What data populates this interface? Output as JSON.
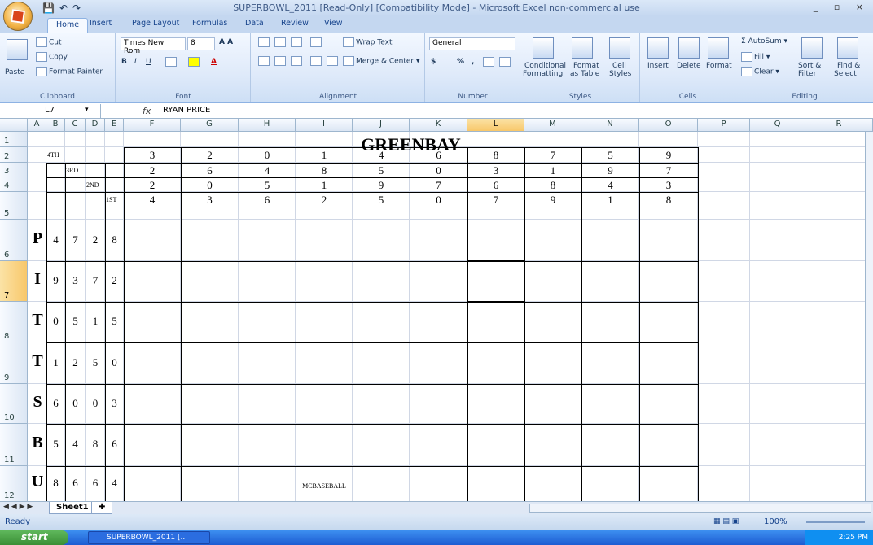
{
  "window": {
    "title": "SUPERBOWL_2011  [Read-Only]  [Compatibility Mode] - Microsoft Excel non-commercial use",
    "controls": "_ ▫ ×"
  },
  "qat": {
    "save": "💾",
    "undo": "↶",
    "redo": "↷"
  },
  "ribbon": {
    "tabs": [
      "Home",
      "Insert",
      "Page Layout",
      "Formulas",
      "Data",
      "Review",
      "View"
    ],
    "clipboard": {
      "paste": "Paste",
      "cut": "Cut",
      "copy": "Copy",
      "format_painter": "Format Painter",
      "label": "Clipboard"
    },
    "font": {
      "name": "Times New Rom",
      "size": "8",
      "label": "Font"
    },
    "alignment": {
      "wrap": "Wrap Text",
      "merge": "Merge & Center",
      "label": "Alignment"
    },
    "number": {
      "format": "General",
      "currency": "$",
      "percent": "%",
      "comma": ",",
      "label": "Number"
    },
    "styles": {
      "conditional": "Conditional",
      "conditional2": "Formatting",
      "format_table": "Format",
      "format_table2": "as Table",
      "cell_styles": "Cell",
      "cell_styles2": "Styles",
      "label": "Styles"
    },
    "cells": {
      "insert": "Insert",
      "delete": "Delete",
      "format": "Format",
      "label": "Cells"
    },
    "editing": {
      "autosum": "AutoSum",
      "fill": "Fill",
      "clear": "Clear",
      "sort": "Sort &",
      "sort2": "Filter",
      "find": "Find &",
      "find2": "Select",
      "label": "Editing"
    }
  },
  "formula_bar": {
    "name_box": "L7",
    "fx": "fx",
    "content": "RYAN PRICE"
  },
  "columns": [
    "A",
    "B",
    "C",
    "D",
    "E",
    "F",
    "G",
    "H",
    "I",
    "J",
    "K",
    "L",
    "M",
    "N",
    "O",
    "P",
    "Q",
    "R"
  ],
  "rows": [
    "1",
    "2",
    "3",
    "4",
    "5",
    "6",
    "7",
    "8",
    "9",
    "10",
    "11",
    "12"
  ],
  "sheet": {
    "title": "GREENBAY",
    "quarter_labels": [
      "4TH",
      "3RD",
      "2ND",
      "1ST"
    ],
    "greenbay_numbers": [
      [
        "3",
        "2",
        "0",
        "1",
        "4",
        "6",
        "8",
        "7",
        "5",
        "9"
      ],
      [
        "2",
        "6",
        "4",
        "8",
        "5",
        "0",
        "3",
        "1",
        "9",
        "7"
      ],
      [
        "2",
        "0",
        "5",
        "1",
        "9",
        "7",
        "6",
        "8",
        "4",
        "3"
      ],
      [
        "4",
        "3",
        "6",
        "2",
        "5",
        "0",
        "7",
        "9",
        "1",
        "8"
      ]
    ],
    "pitts_rows": [
      {
        "letter": "P",
        "nums": [
          "4",
          "7",
          "2",
          "8"
        ]
      },
      {
        "letter": "I",
        "nums": [
          "9",
          "3",
          "7",
          "2"
        ]
      },
      {
        "letter": "T",
        "nums": [
          "0",
          "5",
          "1",
          "5"
        ]
      },
      {
        "letter": "T",
        "nums": [
          "1",
          "2",
          "5",
          "0"
        ]
      },
      {
        "letter": "S",
        "nums": [
          "6",
          "0",
          "0",
          "3"
        ]
      },
      {
        "letter": "B",
        "nums": [
          "5",
          "4",
          "8",
          "6"
        ]
      },
      {
        "letter": "U",
        "nums": [
          "8",
          "6",
          "6",
          "4"
        ]
      }
    ],
    "square_name": "MCBASEBALL"
  },
  "sheet_tabs": {
    "active": "Sheet1"
  },
  "status": {
    "ready": "Ready",
    "zoom": "100%"
  },
  "taskbar": {
    "start": "start",
    "item": "SUPERBOWL_2011 [...",
    "clock": "2:25 PM"
  }
}
